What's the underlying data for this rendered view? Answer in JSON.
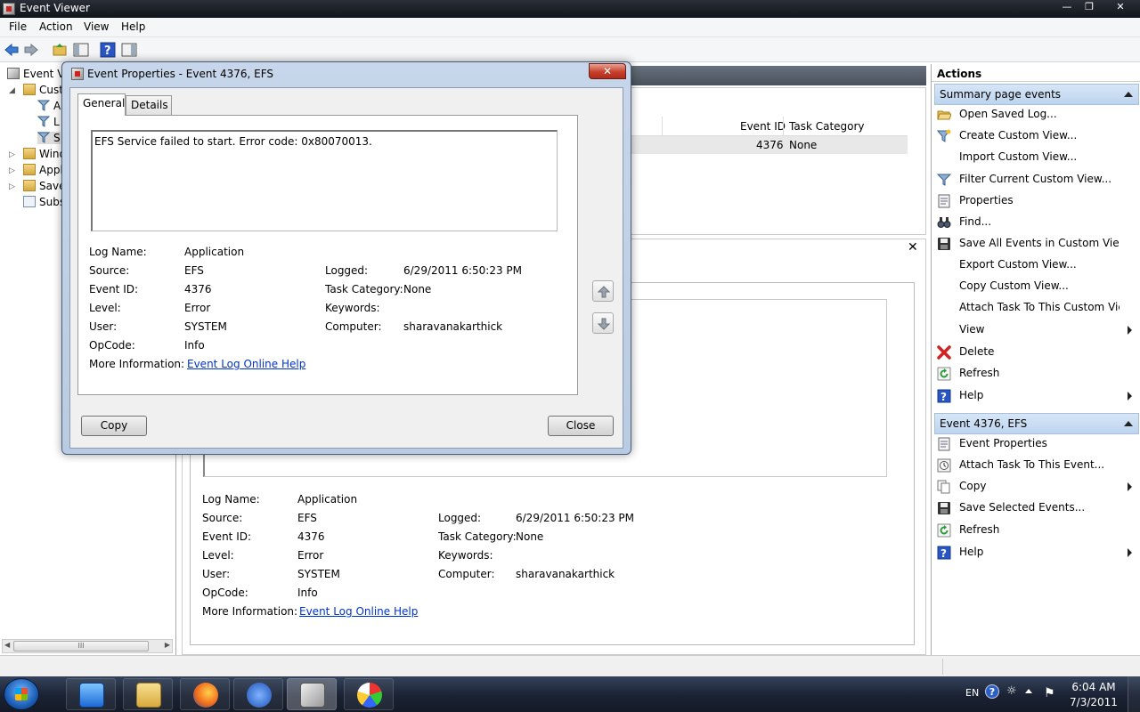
{
  "window": {
    "title": "Event Viewer"
  },
  "menu": [
    "File",
    "Action",
    "View",
    "Help"
  ],
  "tree": {
    "items": [
      {
        "label": "Event Vi",
        "icon": "event-viewer-icon"
      },
      {
        "label": "Cust",
        "icon": "folder-icon"
      },
      {
        "label": "A",
        "icon": "filter-icon"
      },
      {
        "label": "L",
        "icon": "filter-icon"
      },
      {
        "label": "S",
        "icon": "filter-icon"
      },
      {
        "label": "Wind",
        "icon": "folder-icon"
      },
      {
        "label": "Appl",
        "icon": "folder-icon"
      },
      {
        "label": "Save",
        "icon": "folder-icon"
      },
      {
        "label": "Subs",
        "icon": "subscriptions-icon"
      }
    ],
    "scroll_label": "III"
  },
  "grid": {
    "columns": [
      "Event ID",
      "Task Category"
    ],
    "row": {
      "event_id": "4376",
      "task_category": "None"
    }
  },
  "details": {
    "log_name_label": "Log Name:",
    "log_name": "Application",
    "source_label": "Source:",
    "source": "EFS",
    "logged_label": "Logged:",
    "logged": "6/29/2011 6:50:23 PM",
    "event_id_label": "Event ID:",
    "event_id": "4376",
    "task_category_label": "Task Category:",
    "task_category": "None",
    "level_label": "Level:",
    "level": "Error",
    "keywords_label": "Keywords:",
    "user_label": "User:",
    "user": "SYSTEM",
    "computer_label": "Computer:",
    "computer": "sharavanakarthick",
    "opcode_label": "OpCode:",
    "opcode": "Info",
    "more_info_label": "More Information:",
    "more_info_link": "Event Log Online Help"
  },
  "dialog": {
    "title": "Event Properties - Event 4376, EFS",
    "tabs": [
      "General",
      "Details"
    ],
    "description": "EFS Service failed to start. Error code: 0x80070013.",
    "copy_label": "Copy",
    "close_label": "Close"
  },
  "actions": {
    "title": "Actions",
    "section1": {
      "title": "Summary page events",
      "items": [
        {
          "label": "Open Saved Log...",
          "icon": "open-folder-icon"
        },
        {
          "label": "Create Custom View...",
          "icon": "filter-create-icon"
        },
        {
          "label": "Import Custom View...",
          "icon": ""
        },
        {
          "label": "Filter Current Custom View...",
          "icon": "filter-icon"
        },
        {
          "label": "Properties",
          "icon": "properties-icon"
        },
        {
          "label": "Find...",
          "icon": "binoculars-icon"
        },
        {
          "label": "Save All Events in Custom View ...",
          "icon": "save-icon"
        },
        {
          "label": "Export Custom View...",
          "icon": ""
        },
        {
          "label": "Copy Custom View...",
          "icon": ""
        },
        {
          "label": "Attach Task To This Custom Vie...",
          "icon": ""
        },
        {
          "label": "View",
          "icon": "",
          "submenu": true
        },
        {
          "label": "Delete",
          "icon": "delete-icon"
        },
        {
          "label": "Refresh",
          "icon": "refresh-icon"
        },
        {
          "label": "Help",
          "icon": "help-icon",
          "submenu": true
        }
      ]
    },
    "section2": {
      "title": "Event 4376, EFS",
      "items": [
        {
          "label": "Event Properties",
          "icon": "properties-icon"
        },
        {
          "label": "Attach Task To This Event...",
          "icon": "task-icon"
        },
        {
          "label": "Copy",
          "icon": "copy-icon",
          "submenu": true
        },
        {
          "label": "Save Selected Events...",
          "icon": "save-icon"
        },
        {
          "label": "Refresh",
          "icon": "refresh-icon"
        },
        {
          "label": "Help",
          "icon": "help-icon",
          "submenu": true
        }
      ]
    }
  },
  "taskbar": {
    "apps": [
      "media-player-icon",
      "explorer-icon",
      "firefox-icon",
      "hp-icon",
      "event-viewer-icon",
      "paint-icon"
    ],
    "language": "EN",
    "time": "6:04 AM",
    "date": "7/3/2011"
  },
  "colors": {
    "accent": "#bdd4ee",
    "link": "#0033cc",
    "error_red": "#d42020"
  }
}
